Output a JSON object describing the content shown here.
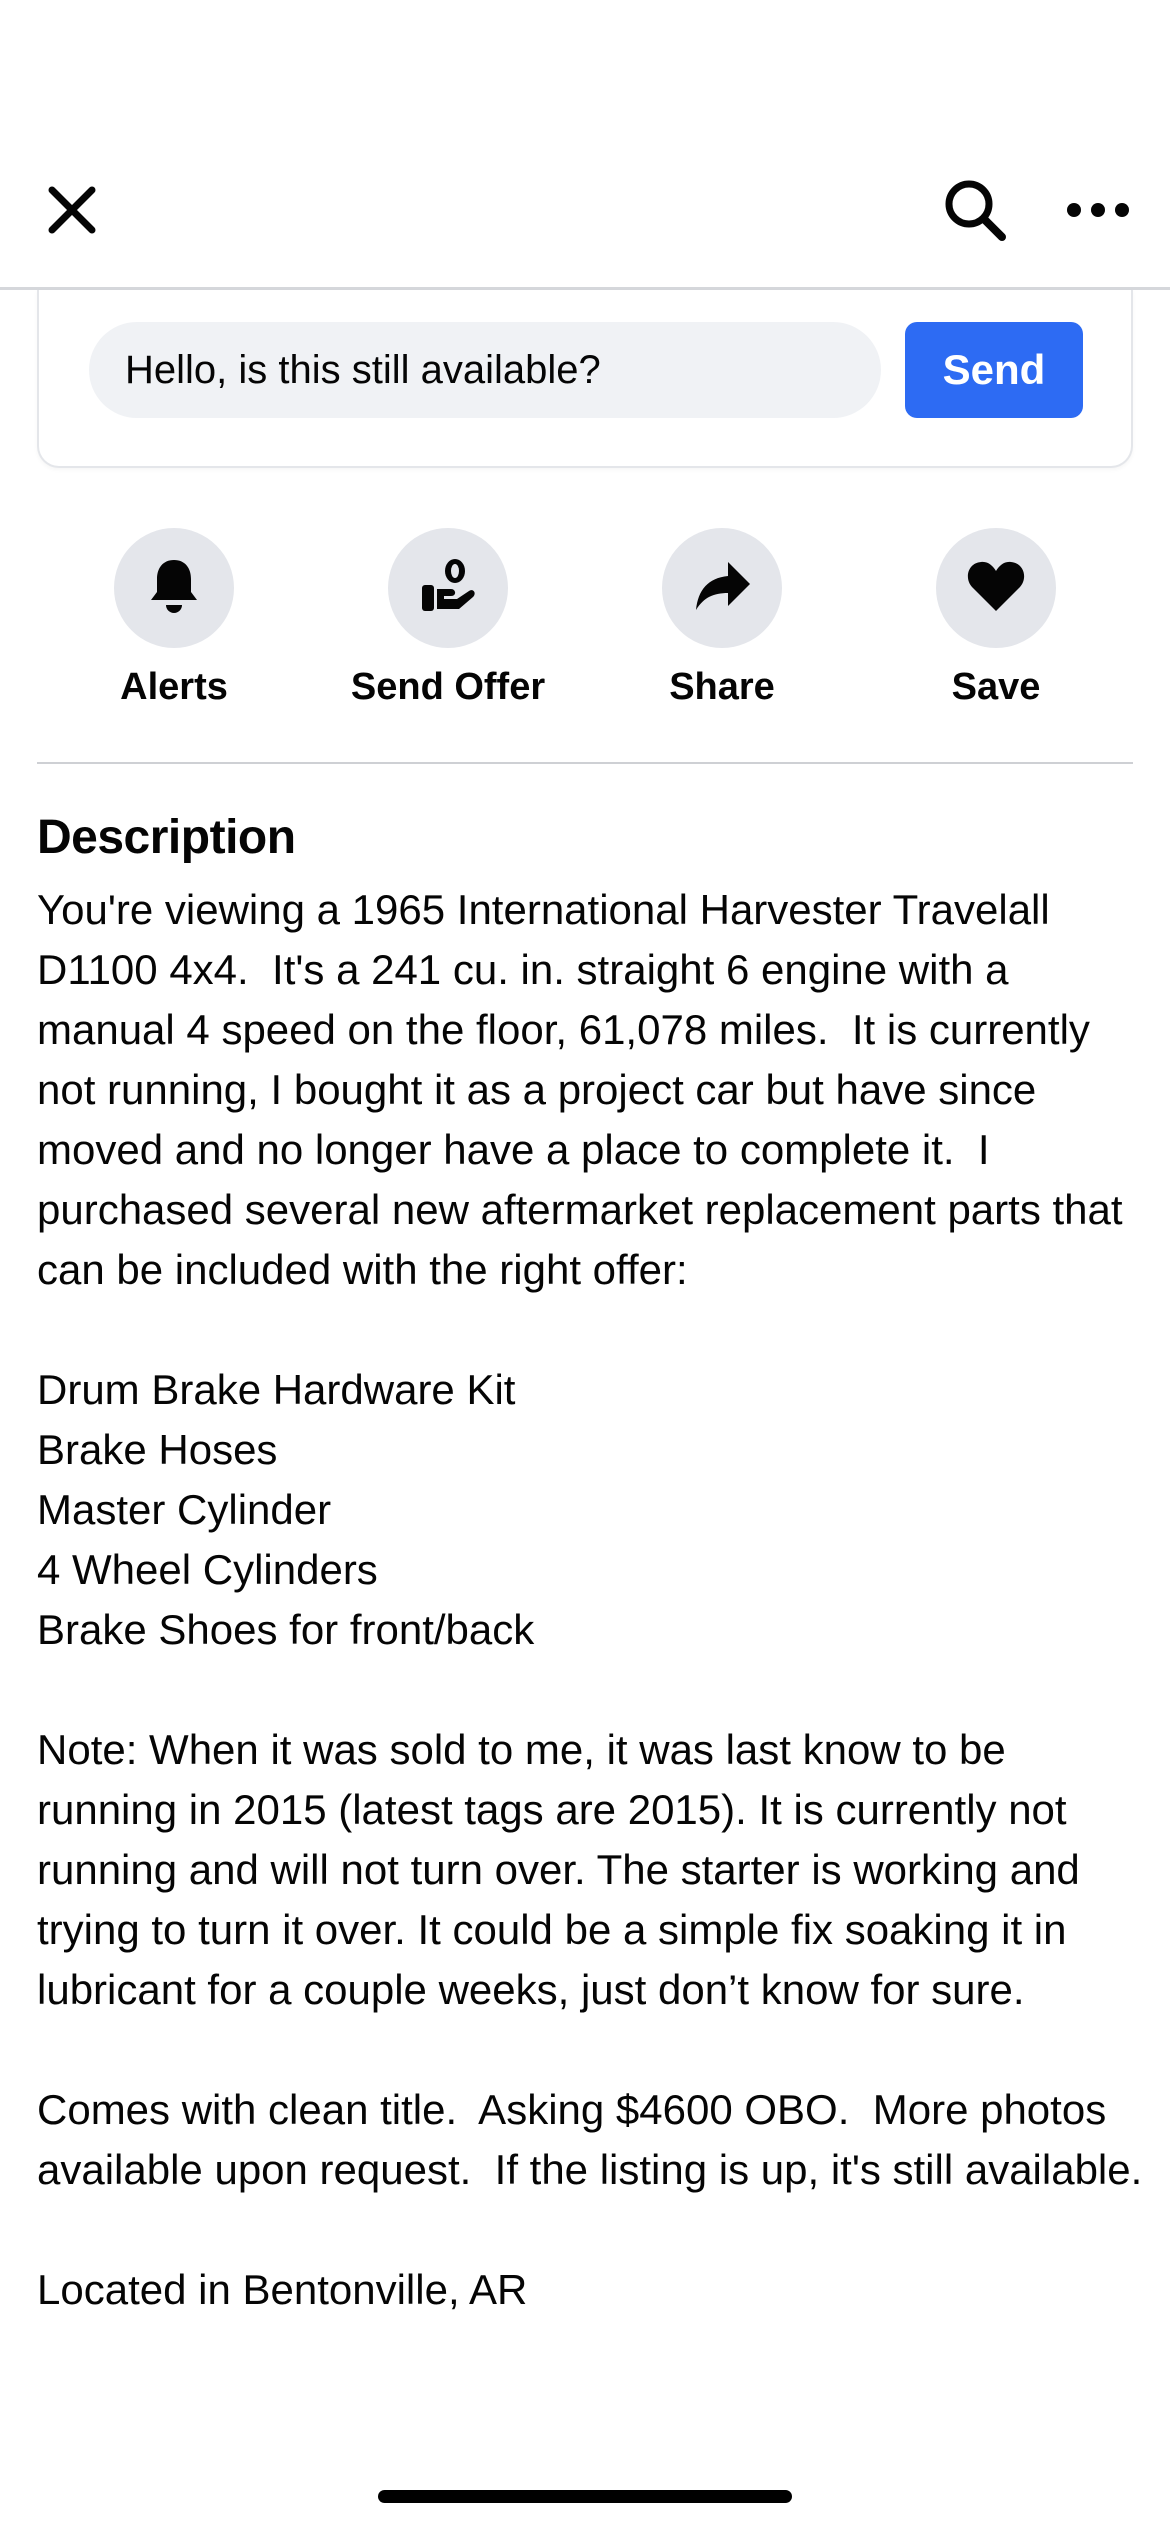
{
  "header": {
    "close_icon": "close-icon",
    "search_icon": "search-icon",
    "more_icon": "more-horizontal-icon"
  },
  "message": {
    "value": "Hello, is this still available?",
    "send_label": "Send",
    "accent_color": "#2d6bf3"
  },
  "actions": [
    {
      "label": "Alerts",
      "icon": "bell-icon"
    },
    {
      "label": "Send Offer",
      "icon": "offer-hand-icon"
    },
    {
      "label": "Share",
      "icon": "share-arrow-icon"
    },
    {
      "label": "Save",
      "icon": "heart-icon"
    }
  ],
  "description": {
    "heading": "Description",
    "paragraphs": [
      "You're viewing a 1965 International Harvester Travelall D1100 4x4.  It's a 241 cu. in. straight 6 engine with a manual 4 speed on the floor, 61,078 miles.  It is currently not running, I bought it as a project car but have since moved and no longer have a place to complete it.  I purchased several new aftermarket replacement parts that can be included with the right offer:",
      "Drum Brake Hardware Kit\nBrake Hoses\nMaster Cylinder\n4 Wheel Cylinders\nBrake Shoes for front/back",
      "Note: When it was sold to me, it was last know to be running in 2015 (latest tags are 2015). It is currently not running and will not turn over. The starter is working and trying to turn it over. It could be a simple fix soaking it in lubricant for a couple weeks, just don’t know for sure.",
      "Comes with clean title.  Asking $4600 OBO.  More photos available upon request.  If the listing is up, it's still available.",
      "Located in Bentonville, AR"
    ]
  }
}
